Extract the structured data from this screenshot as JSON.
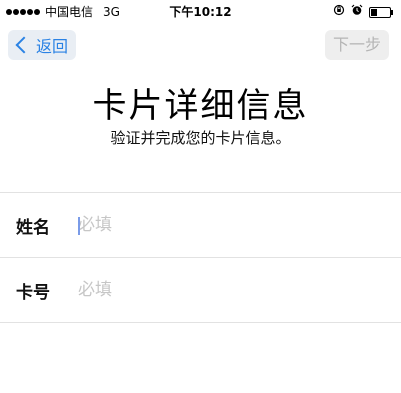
{
  "status_bar": {
    "carrier": "中国电信",
    "network": "3G",
    "time": "下午10:12"
  },
  "nav": {
    "back_label": "返回",
    "next_label": "下一步"
  },
  "header": {
    "title": "卡片详细信息",
    "subtitle": "验证并完成您的卡片信息。"
  },
  "form": {
    "fields": [
      {
        "label": "姓名",
        "placeholder": "必填",
        "value": ""
      },
      {
        "label": "卡号",
        "placeholder": "必填",
        "value": ""
      }
    ]
  },
  "colors": {
    "accent": "#2a82e4",
    "disabled_text": "#b5b5b5",
    "placeholder": "#c6c6c6"
  }
}
